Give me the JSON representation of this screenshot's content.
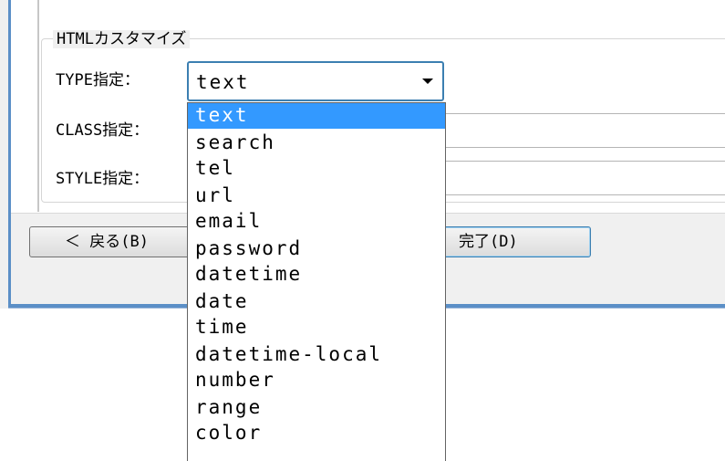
{
  "group": {
    "title": "HTMLカスタマイズ"
  },
  "fields": {
    "type_label": "TYPE指定：",
    "class_label": "CLASS指定：",
    "style_label": "STYLE指定：",
    "type_value": "text",
    "class_value": "",
    "style_value": ""
  },
  "buttons": {
    "back": "＜ 戻る(B)",
    "finish": "完了(D)"
  },
  "dropdown": {
    "selected": "text",
    "options": [
      "text",
      "search",
      "tel",
      "url",
      "email",
      "password",
      "datetime",
      "date",
      "time",
      "datetime-local",
      "number",
      "range",
      "color"
    ]
  },
  "colors": {
    "selection": "#3399ff",
    "focus_border": "#3c7fb1",
    "window_frame": "#5b8fc7"
  },
  "icons": {
    "combo_arrow": "chevron-down-icon"
  }
}
